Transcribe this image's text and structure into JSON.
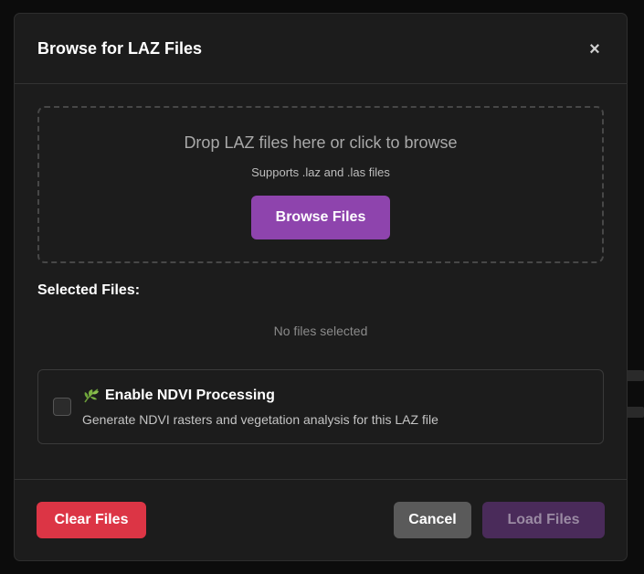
{
  "dialog": {
    "title": "Browse for LAZ Files",
    "close_label": "×"
  },
  "dropzone": {
    "title": "Drop LAZ files here or click to browse",
    "subtitle": "Supports .laz and .las files",
    "browse_label": "Browse Files"
  },
  "files": {
    "label": "Selected Files:",
    "empty_text": "No files selected"
  },
  "ndvi": {
    "icon": "leaf-icon",
    "title": "Enable NDVI Processing",
    "description": "Generate NDVI rasters and vegetation analysis for this LAZ file",
    "checked": false
  },
  "footer": {
    "clear_label": "Clear Files",
    "cancel_label": "Cancel",
    "load_label": "Load Files"
  },
  "colors": {
    "accent": "#8e44ad",
    "danger": "#dc3545",
    "neutral": "#5a5a5a",
    "disabled_accent": "#4a2b5a"
  }
}
